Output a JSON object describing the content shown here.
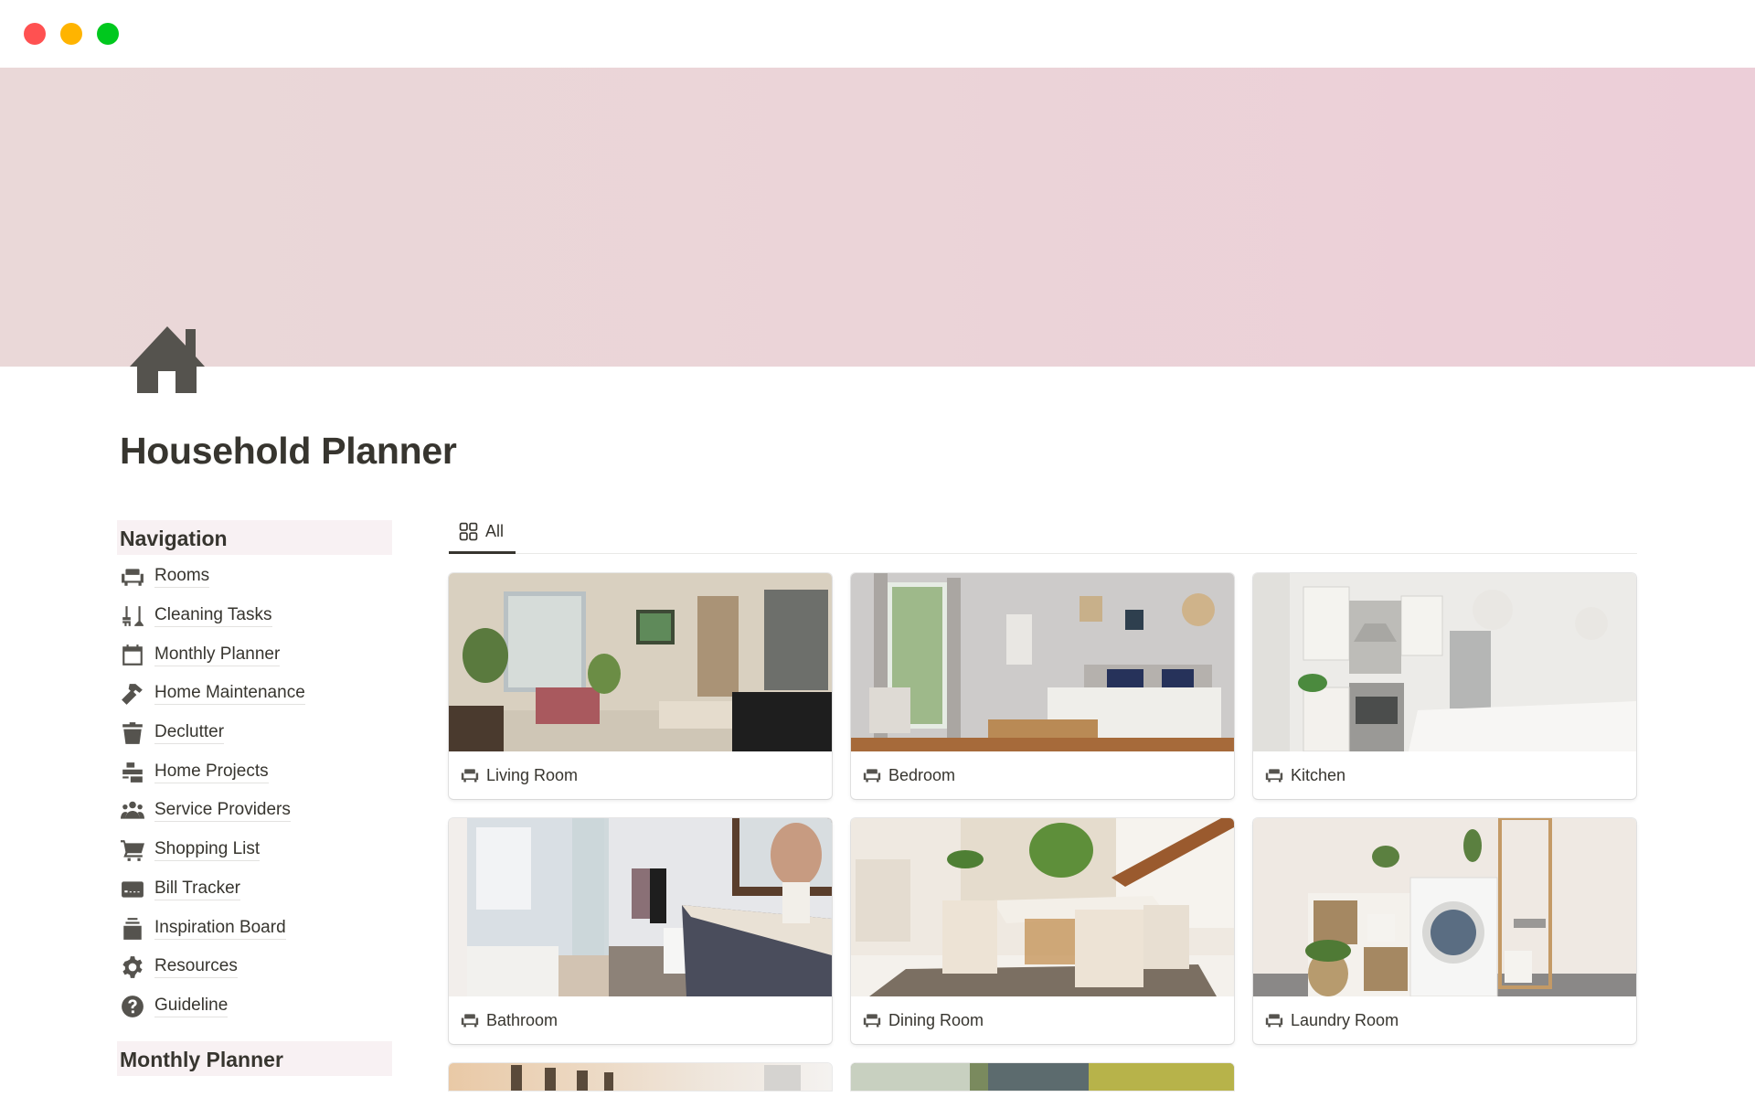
{
  "window": {
    "controls": [
      "close",
      "minimize",
      "maximize"
    ],
    "colors": {
      "close": "#ff5151",
      "minimize": "#ffb400",
      "maximize": "#00c81e"
    }
  },
  "cover": {
    "color": "#ebd4d8"
  },
  "page": {
    "icon": "house-icon",
    "title": "Household Planner"
  },
  "navigation": {
    "heading": "Navigation",
    "items": [
      {
        "label": "Rooms",
        "icon": "armchair-icon"
      },
      {
        "label": "Cleaning Tasks",
        "icon": "broom-icon"
      },
      {
        "label": "Monthly Planner",
        "icon": "calendar-icon"
      },
      {
        "label": "Home Maintenance",
        "icon": "hammer-icon"
      },
      {
        "label": "Declutter",
        "icon": "trash-bin-icon"
      },
      {
        "label": "Home Projects",
        "icon": "bricks-icon"
      },
      {
        "label": "Service Providers",
        "icon": "people-icon"
      },
      {
        "label": "Shopping List",
        "icon": "cart-icon"
      },
      {
        "label": "Bill Tracker",
        "icon": "credit-card-icon"
      },
      {
        "label": "Inspiration Board",
        "icon": "stack-icon"
      },
      {
        "label": "Resources",
        "icon": "gear-icon"
      },
      {
        "label": "Guideline",
        "icon": "question-circle-icon"
      }
    ],
    "second_heading": "Monthly Planner"
  },
  "gallery": {
    "tabs": [
      {
        "label": "All",
        "icon": "gallery-grid-icon",
        "active": true
      }
    ],
    "cards": [
      {
        "title": "Living Room",
        "icon": "armchair-icon"
      },
      {
        "title": "Bedroom",
        "icon": "armchair-icon"
      },
      {
        "title": "Kitchen",
        "icon": "armchair-icon"
      },
      {
        "title": "Bathroom",
        "icon": "armchair-icon"
      },
      {
        "title": "Dining Room",
        "icon": "armchair-icon"
      },
      {
        "title": "Laundry Room",
        "icon": "armchair-icon"
      }
    ]
  }
}
